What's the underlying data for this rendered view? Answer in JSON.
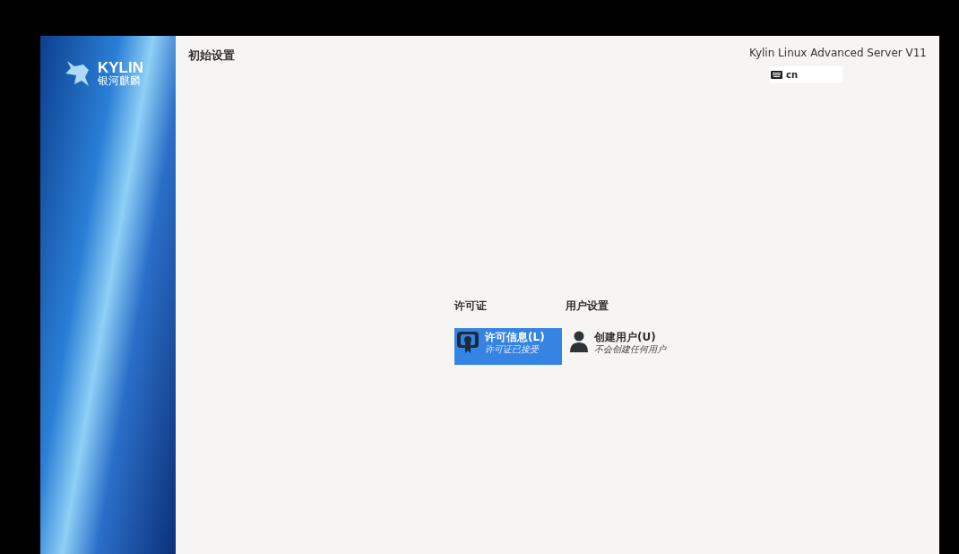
{
  "sidebar": {
    "logo": {
      "wordmark": "KYLIN",
      "subtitle": "银河麒麟"
    }
  },
  "header": {
    "title": "初始设置",
    "product": "Kylin Linux Advanced Server V11",
    "keyboard_layout": "cn"
  },
  "sections": [
    {
      "heading": "许可证",
      "items": [
        {
          "kind": "license",
          "label": "许可信息(L)",
          "status": "许可证已接受",
          "selected": true
        }
      ]
    },
    {
      "heading": "用户设置",
      "items": [
        {
          "kind": "user",
          "label": "创建用户(U)",
          "status": "不会创建任何用户",
          "selected": false
        }
      ]
    }
  ]
}
